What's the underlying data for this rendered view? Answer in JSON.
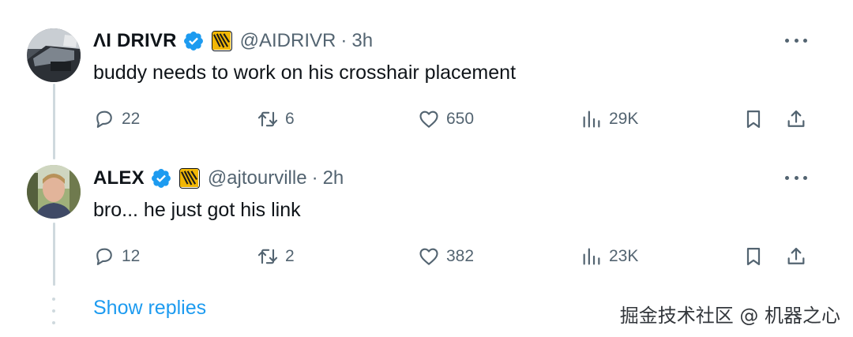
{
  "tweets": [
    {
      "display_name": "ΛI DRIVR",
      "handle": "@AIDRIVR",
      "dot": "·",
      "time": "3h",
      "text": "buddy needs to work on his crosshair placement",
      "replies": "22",
      "reposts": "6",
      "likes": "650",
      "views": "29K"
    },
    {
      "display_name": "ALEX",
      "handle": "@ajtourville",
      "dot": "·",
      "time": "2h",
      "text": "bro... he just got his link",
      "replies": "12",
      "reposts": "2",
      "likes": "382",
      "views": "23K"
    }
  ],
  "show_replies": "Show replies",
  "watermark": "掘金技术社区 @ 机器之心",
  "colors": {
    "text_primary": "#0f1419",
    "text_secondary": "#536471",
    "link": "#1d9bf0",
    "verified": "#1d9bf0",
    "thread_line": "#cfd9de"
  },
  "icons": [
    "reply-icon",
    "repost-icon",
    "like-icon",
    "views-icon",
    "bookmark-icon",
    "share-icon",
    "more-icon",
    "verified-badge-icon",
    "affiliate-badge-icon"
  ]
}
